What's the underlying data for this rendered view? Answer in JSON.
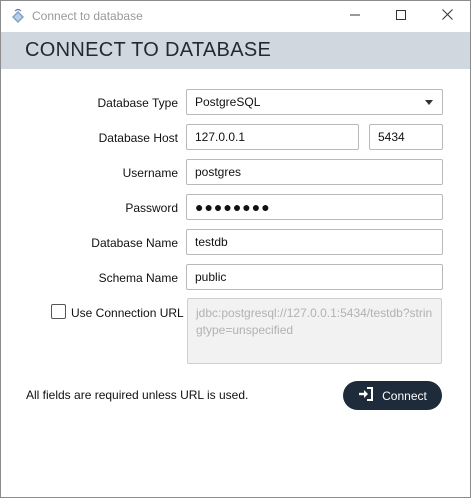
{
  "window": {
    "title": "Connect to database",
    "controls": {
      "minimize": "minimize-icon",
      "maximize": "maximize-icon",
      "close": "close-icon"
    }
  },
  "header": {
    "title": "CONNECT TO DATABASE"
  },
  "form": {
    "db_type_label": "Database Type",
    "db_type_value": "PostgreSQL",
    "db_host_label": "Database Host",
    "db_host_value": "127.0.0.1",
    "db_port_value": "5434",
    "username_label": "Username",
    "username_value": "postgres",
    "password_label": "Password",
    "password_masked": "●●●●●●●●",
    "db_name_label": "Database Name",
    "db_name_value": "testdb",
    "schema_label": "Schema Name",
    "schema_value": "public",
    "use_url_label": "Use Connection URL",
    "use_url_checked": false,
    "url_value": "jdbc:postgresql://127.0.0.1:5434/testdb?stringtype=unspecified"
  },
  "footer": {
    "note": "All fields are required unless URL is used.",
    "connect_label": "Connect"
  },
  "colors": {
    "header_bg": "#d1d7de",
    "button_bg": "#1d2b3a",
    "disabled_text": "#b2b2b2"
  }
}
